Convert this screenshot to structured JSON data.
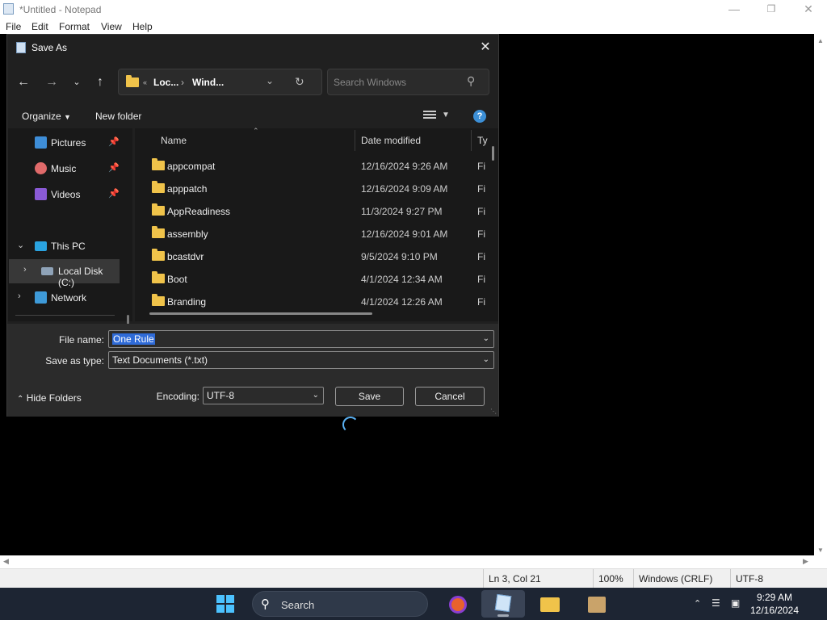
{
  "notepad": {
    "title": "*Untitled - Notepad",
    "menu": [
      "File",
      "Edit",
      "Format",
      "View",
      "Help"
    ],
    "status": {
      "position": "Ln 3, Col 21",
      "zoom": "100%",
      "line_endings": "Windows (CRLF)",
      "encoding": "UTF-8"
    }
  },
  "dialog": {
    "title": "Save As",
    "breadcrumb": [
      "Loc...",
      "Wind..."
    ],
    "search_placeholder": "Search Windows",
    "organize_label": "Organize",
    "new_folder_label": "New folder",
    "help_glyph": "?",
    "nav": {
      "pictures": "Pictures",
      "music": "Music",
      "videos": "Videos",
      "this_pc": "This PC",
      "local_disk": "Local Disk (C:)",
      "network": "Network"
    },
    "columns": {
      "name": "Name",
      "date": "Date modified",
      "type": "Ty"
    },
    "files": [
      {
        "name": "appcompat",
        "date": "12/16/2024 9:26 AM",
        "type": "Fi"
      },
      {
        "name": "apppatch",
        "date": "12/16/2024 9:09 AM",
        "type": "Fi"
      },
      {
        "name": "AppReadiness",
        "date": "11/3/2024 9:27 PM",
        "type": "Fi"
      },
      {
        "name": "assembly",
        "date": "12/16/2024 9:01 AM",
        "type": "Fi"
      },
      {
        "name": "bcastdvr",
        "date": "9/5/2024 9:10 PM",
        "type": "Fi"
      },
      {
        "name": "Boot",
        "date": "4/1/2024 12:34 AM",
        "type": "Fi"
      },
      {
        "name": "Branding",
        "date": "4/1/2024 12:26 AM",
        "type": "Fi"
      }
    ],
    "file_name_label": "File name:",
    "file_name_value": "One Rule",
    "save_type_label": "Save as type:",
    "save_type_value": "Text Documents (*.txt)",
    "hide_folders_label": "Hide Folders",
    "encoding_label": "Encoding:",
    "encoding_value": "UTF-8",
    "save_label": "Save",
    "cancel_label": "Cancel"
  },
  "taskbar": {
    "search_label": "Search",
    "time": "9:29 AM",
    "date": "12/16/2024"
  },
  "colors": {
    "dialog_bg": "#202020",
    "selection": "#2f6bd8",
    "folder": "#f0c34a",
    "accent": "#4cc2ff",
    "taskbar": "#1d2533"
  }
}
